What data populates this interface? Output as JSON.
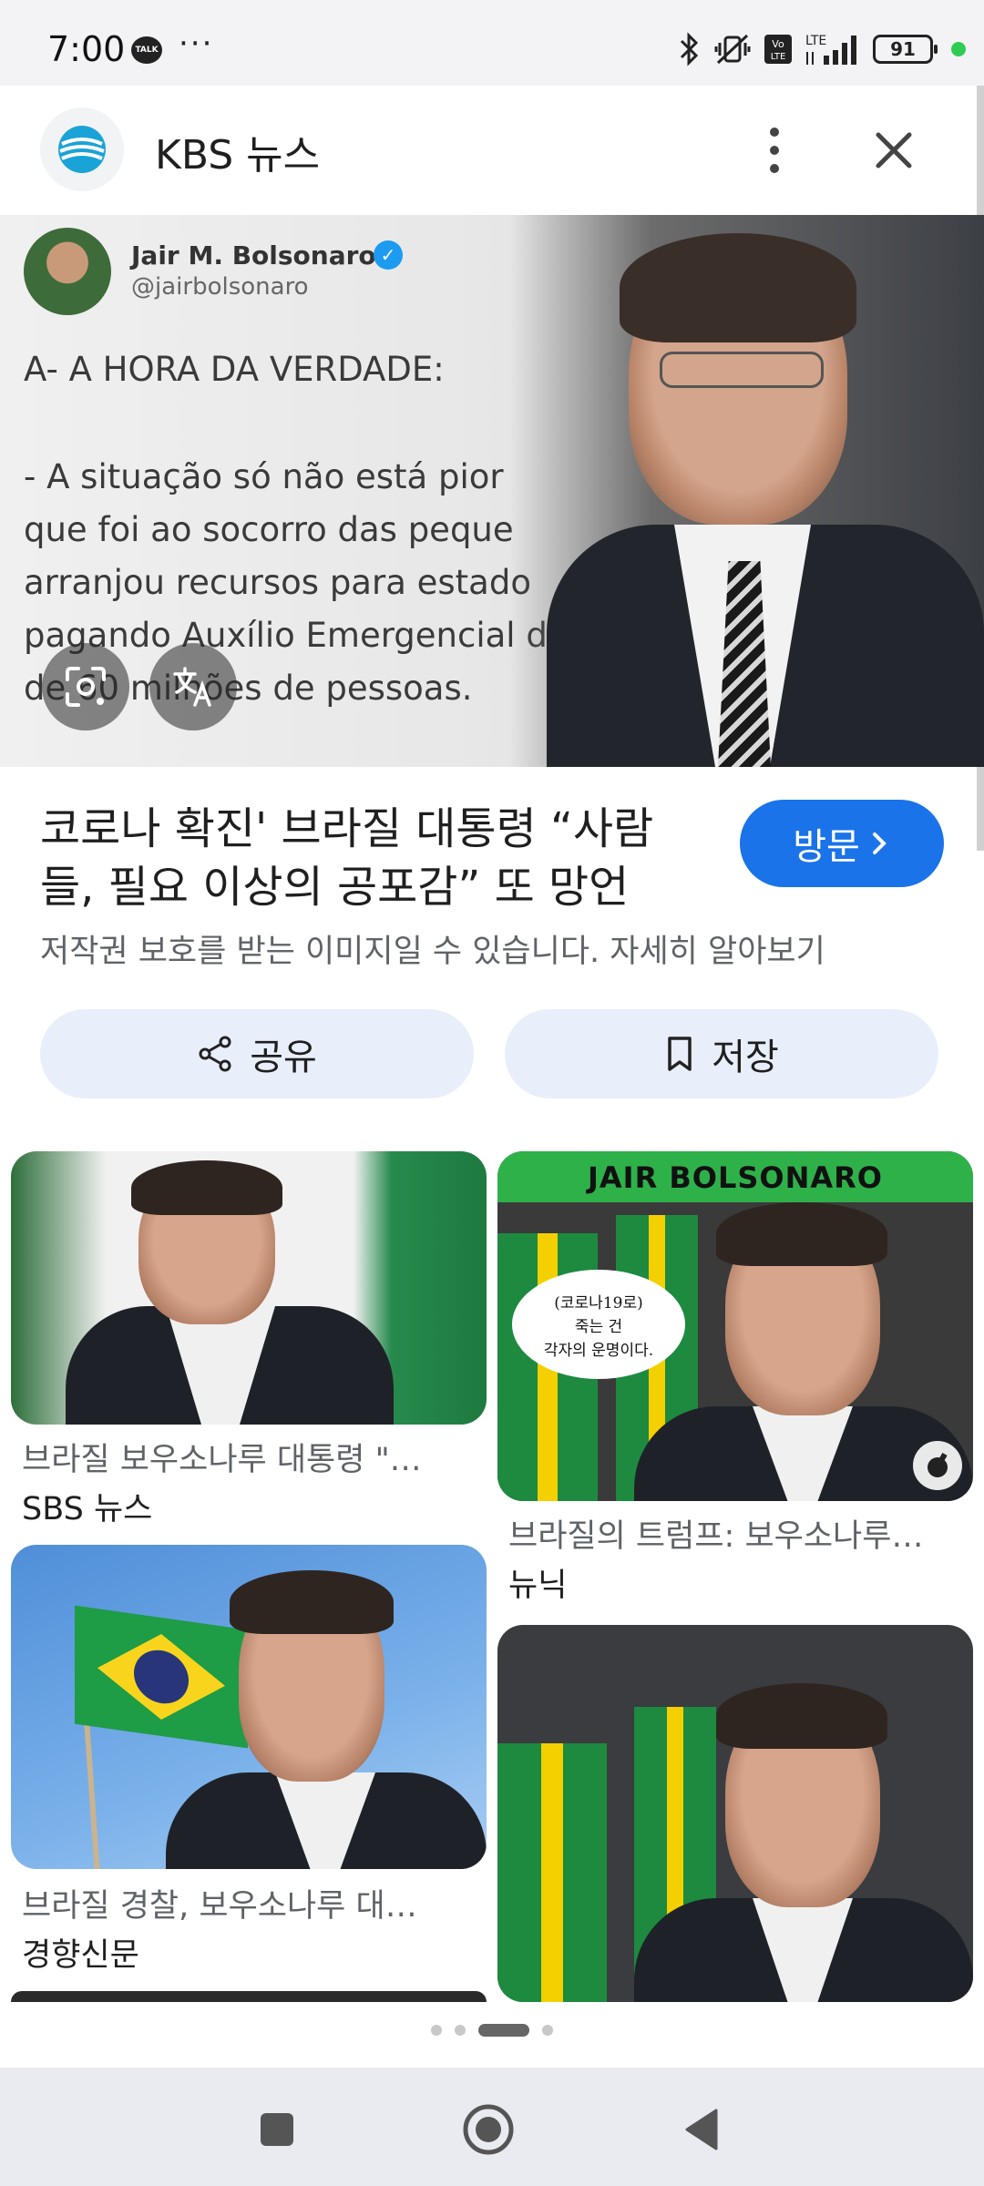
{
  "status_bar": {
    "time": "7:00",
    "talk_label": "TALK",
    "more": "···",
    "lte_label": "LTE",
    "volte_label": "Vo LTE",
    "battery": "91"
  },
  "header": {
    "source_name": "KBS 뉴스"
  },
  "hero": {
    "tweet_name": "Jair M. Bolsonaro",
    "tweet_handle": "@jairbolsonaro",
    "tweet_lines": [
      "A- A HORA DA VERDADE:",
      "- A situação só não está pior",
      "que foi ao socorro das peque",
      "arranjou recursos para estado",
      "pagando Auxílio Emergencial de",
      "de 60 milhões de pessoas."
    ]
  },
  "result": {
    "title": "코로나 확진' 브라질 대통령 “사람들, 필요 이상의 공포감” 또 망언",
    "visit_label": "방문",
    "copyright": "저작권 보호를 받는 이미지일 수 있습니다. 자세히 알아보기",
    "share_label": "공유",
    "save_label": "저장"
  },
  "related": [
    {
      "caption": "브라질 보우소나루 대통령 \"…",
      "source": "SBS 뉴스"
    },
    {
      "caption": "브라질의 트럼프: 보우소나루…",
      "source": "뉴닉",
      "banner": "JAIR BOLSONARO",
      "bubble": "(코로나19로)\n죽는 건\n각자의 운명이다."
    },
    {
      "caption": "브라질 경찰, 보우소나루 대…",
      "source": "경향신문"
    },
    {
      "caption": "",
      "source": ""
    }
  ],
  "colors": {
    "accent": "#1a73e8",
    "chip_bg": "#e8effb",
    "status_bg": "#f3f3f6",
    "nav_bg": "#eaebf1"
  }
}
